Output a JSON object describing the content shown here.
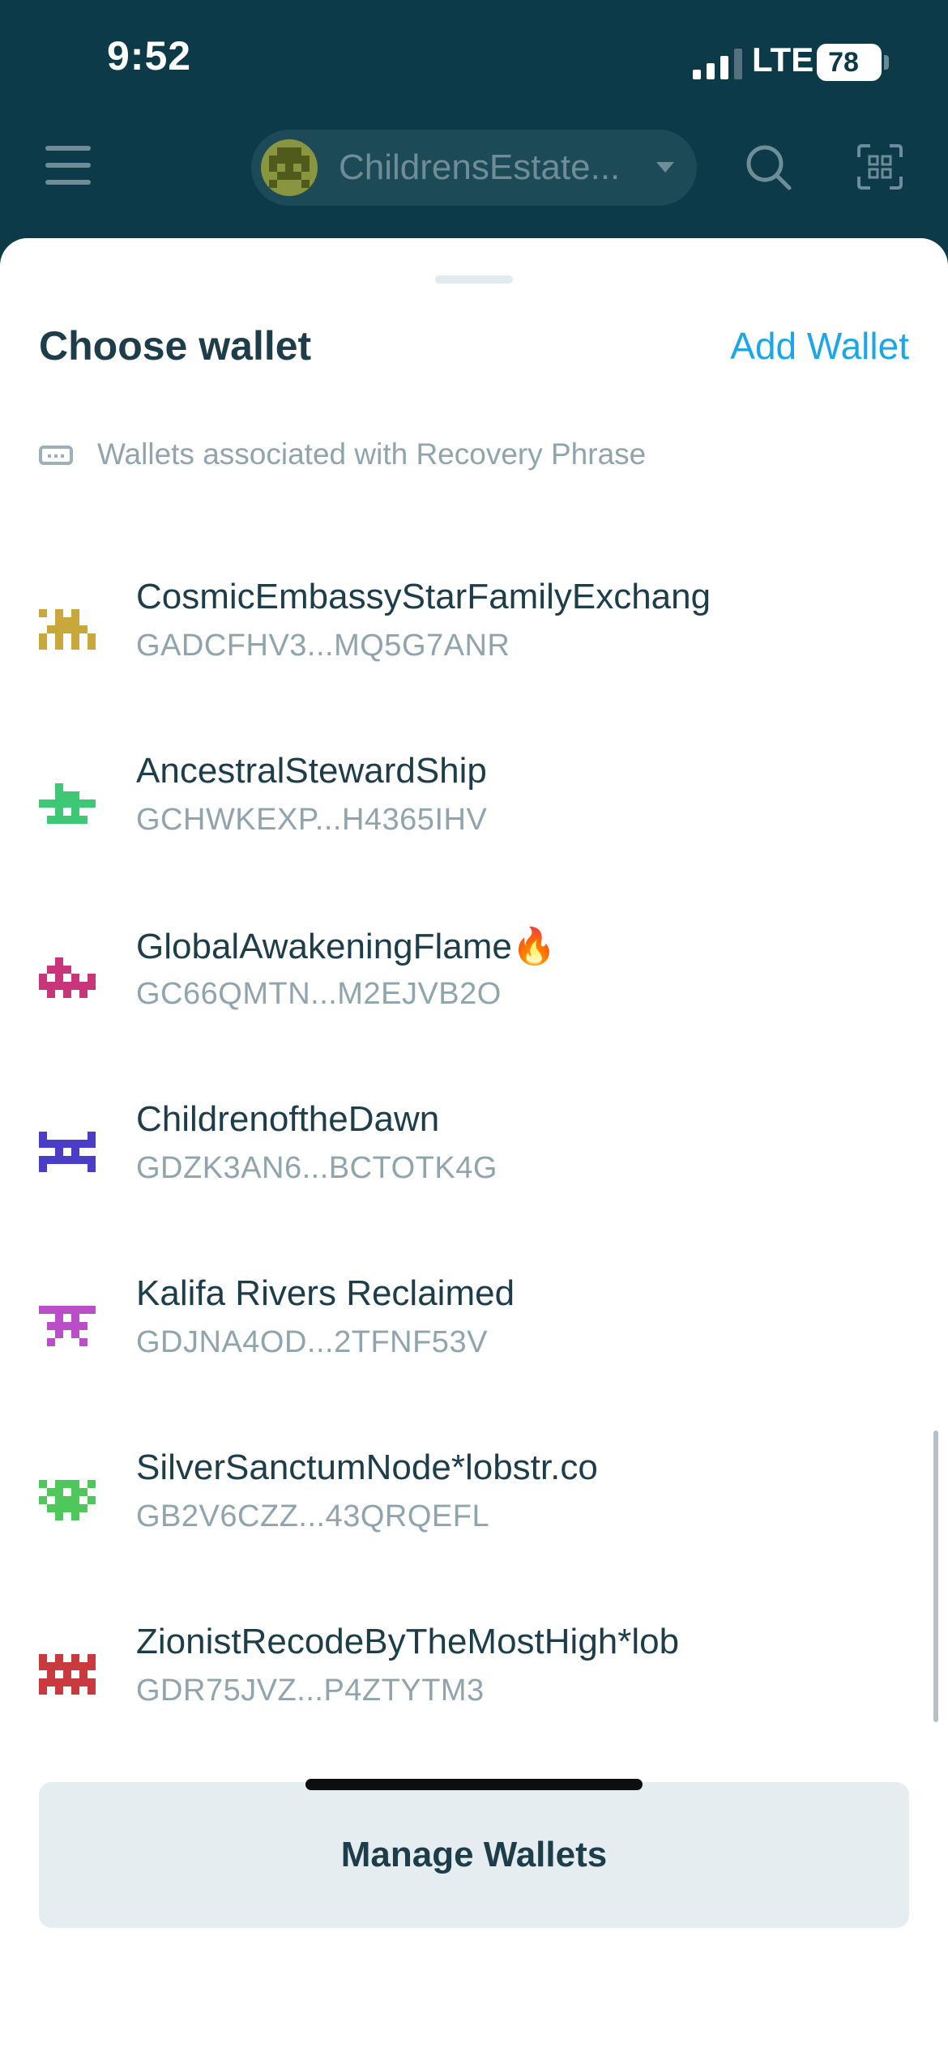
{
  "status_bar": {
    "time": "9:52",
    "network": "LTE",
    "battery": "78"
  },
  "header": {
    "account_name": "ChildrensEstate...",
    "account_avatar_color": "#8a9540"
  },
  "sheet": {
    "title": "Choose wallet",
    "add_wallet_label": "Add Wallet",
    "section_label": "Wallets associated with Recovery Phrase",
    "wallets": [
      {
        "name": "CosmicEmbassyStarFamilyExchang",
        "address": "GADCFHV3...MQ5G7ANR",
        "avatar_color": "#c8a83a",
        "avatar_icon": "pixel-invader-icon"
      },
      {
        "name": "AncestralStewardShip",
        "address": "GCHWKEXP...H4365IHV",
        "avatar_color": "#3ec775",
        "avatar_icon": "pixel-invader-icon"
      },
      {
        "name": "GlobalAwakeningFlame🔥",
        "address": "GC66QMTN...M2EJVB2O",
        "avatar_color": "#c8357a",
        "avatar_icon": "pixel-invader-icon"
      },
      {
        "name": "ChildrenoftheDawn",
        "address": "GDZK3AN6...BCTOTK4G",
        "avatar_color": "#4a3ec8",
        "avatar_icon": "pixel-invader-icon"
      },
      {
        "name": "Kalifa Rivers Reclaimed",
        "address": "GDJNA4OD...2TFNF53V",
        "avatar_color": "#b94ec8",
        "avatar_icon": "pixel-invader-icon"
      },
      {
        "name": "SilverSanctumNode*lobstr.co",
        "address": "GB2V6CZZ...43QRQEFL",
        "avatar_color": "#4ec85a",
        "avatar_icon": "pixel-invader-icon"
      },
      {
        "name": "ZionistRecodeByTheMostHigh*lob",
        "address": "GDR75JVZ...P4ZTYTM3",
        "avatar_color": "#c83a3e",
        "avatar_icon": "pixel-invader-icon"
      }
    ],
    "manage_button_label": "Manage Wallets"
  }
}
